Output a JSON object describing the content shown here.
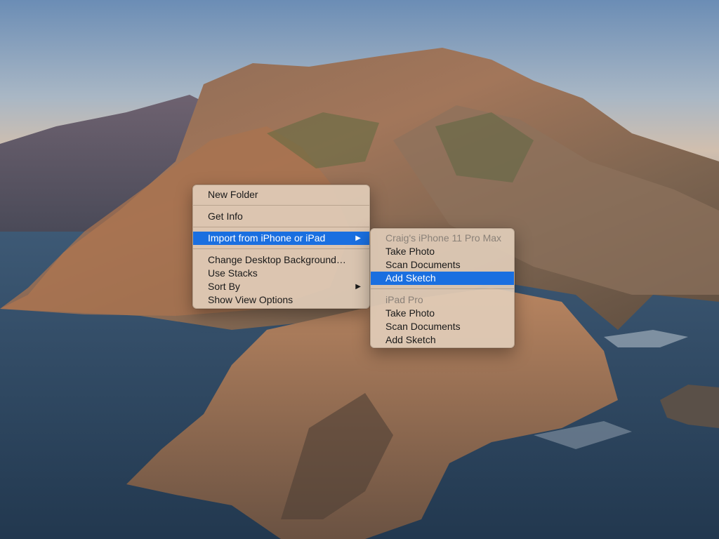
{
  "context_menu": {
    "items": [
      {
        "label": "New Folder"
      },
      {
        "label": "Get Info"
      },
      {
        "label": "Import from iPhone or iPad"
      },
      {
        "label": "Change Desktop Background…"
      },
      {
        "label": "Use Stacks"
      },
      {
        "label": "Sort By"
      },
      {
        "label": "Show View Options"
      }
    ],
    "arrow_glyph": "▶"
  },
  "submenu": {
    "groups": [
      {
        "header": "Craig's iPhone 11 Pro Max",
        "items": [
          {
            "label": "Take Photo"
          },
          {
            "label": "Scan Documents"
          },
          {
            "label": "Add Sketch"
          }
        ]
      },
      {
        "header": "iPad Pro",
        "items": [
          {
            "label": "Take Photo"
          },
          {
            "label": "Scan Documents"
          },
          {
            "label": "Add Sketch"
          }
        ]
      }
    ]
  },
  "colors": {
    "highlight": "#1a6fe0",
    "menu_background": "#e2ceba",
    "disabled_text": "#8a8178"
  }
}
